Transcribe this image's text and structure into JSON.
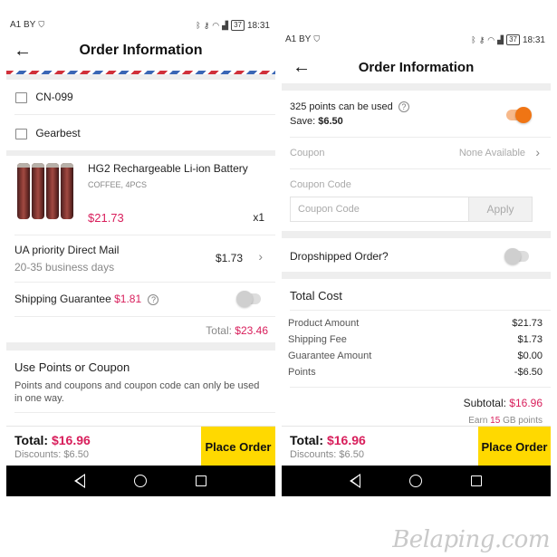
{
  "status_bar": {
    "carrier": "A1 BY",
    "battery": "37",
    "time": "18:31"
  },
  "app_bar": {
    "title": "Order Information"
  },
  "left": {
    "order_id": "CN-099",
    "store": "Gearbest",
    "product": {
      "name": "HG2 Rechargeable Li-ion Battery",
      "variant": "COFFEE, 4PCS",
      "price": "$21.73",
      "qty": "x1"
    },
    "shipping": {
      "method": "UA priority Direct Mail",
      "eta": "20-35 business days",
      "price": "$1.73"
    },
    "guarantee": {
      "label": "Shipping Guarantee",
      "price": "$1.81"
    },
    "total": {
      "label": "Total:",
      "value": "$23.46"
    },
    "points_section": {
      "title": "Use Points or Coupon",
      "description": "Points and coupons and coupon code can only be used in one way."
    }
  },
  "right": {
    "points": {
      "text": "325 points can be used",
      "save_label": "Save:",
      "save_value": "$6.50"
    },
    "coupon": {
      "label": "Coupon",
      "value": "None Available"
    },
    "coupon_code": {
      "label": "Coupon Code",
      "placeholder": "Coupon Code",
      "apply": "Apply"
    },
    "dropship": {
      "label": "Dropshipped Order?"
    },
    "total_cost": {
      "title": "Total Cost",
      "rows": [
        {
          "label": "Product Amount",
          "value": "$21.73"
        },
        {
          "label": "Shipping Fee",
          "value": "$1.73"
        },
        {
          "label": "Guarantee Amount",
          "value": "$0.00"
        },
        {
          "label": "Points",
          "value": "-$6.50"
        }
      ],
      "subtotal_label": "Subtotal:",
      "subtotal_value": "$16.96",
      "earn_prefix": "Earn",
      "earn_value": "15",
      "earn_suffix": "GB points"
    }
  },
  "bottom": {
    "total_label": "Total:",
    "total_value": "$16.96",
    "discounts": "Discounts: $6.50",
    "button": "Place Order"
  },
  "watermark": "Belaping.com",
  "colors": {
    "accent_price": "#d81e5b",
    "button_yellow": "#ffd900",
    "toggle_on": "#f07514"
  }
}
